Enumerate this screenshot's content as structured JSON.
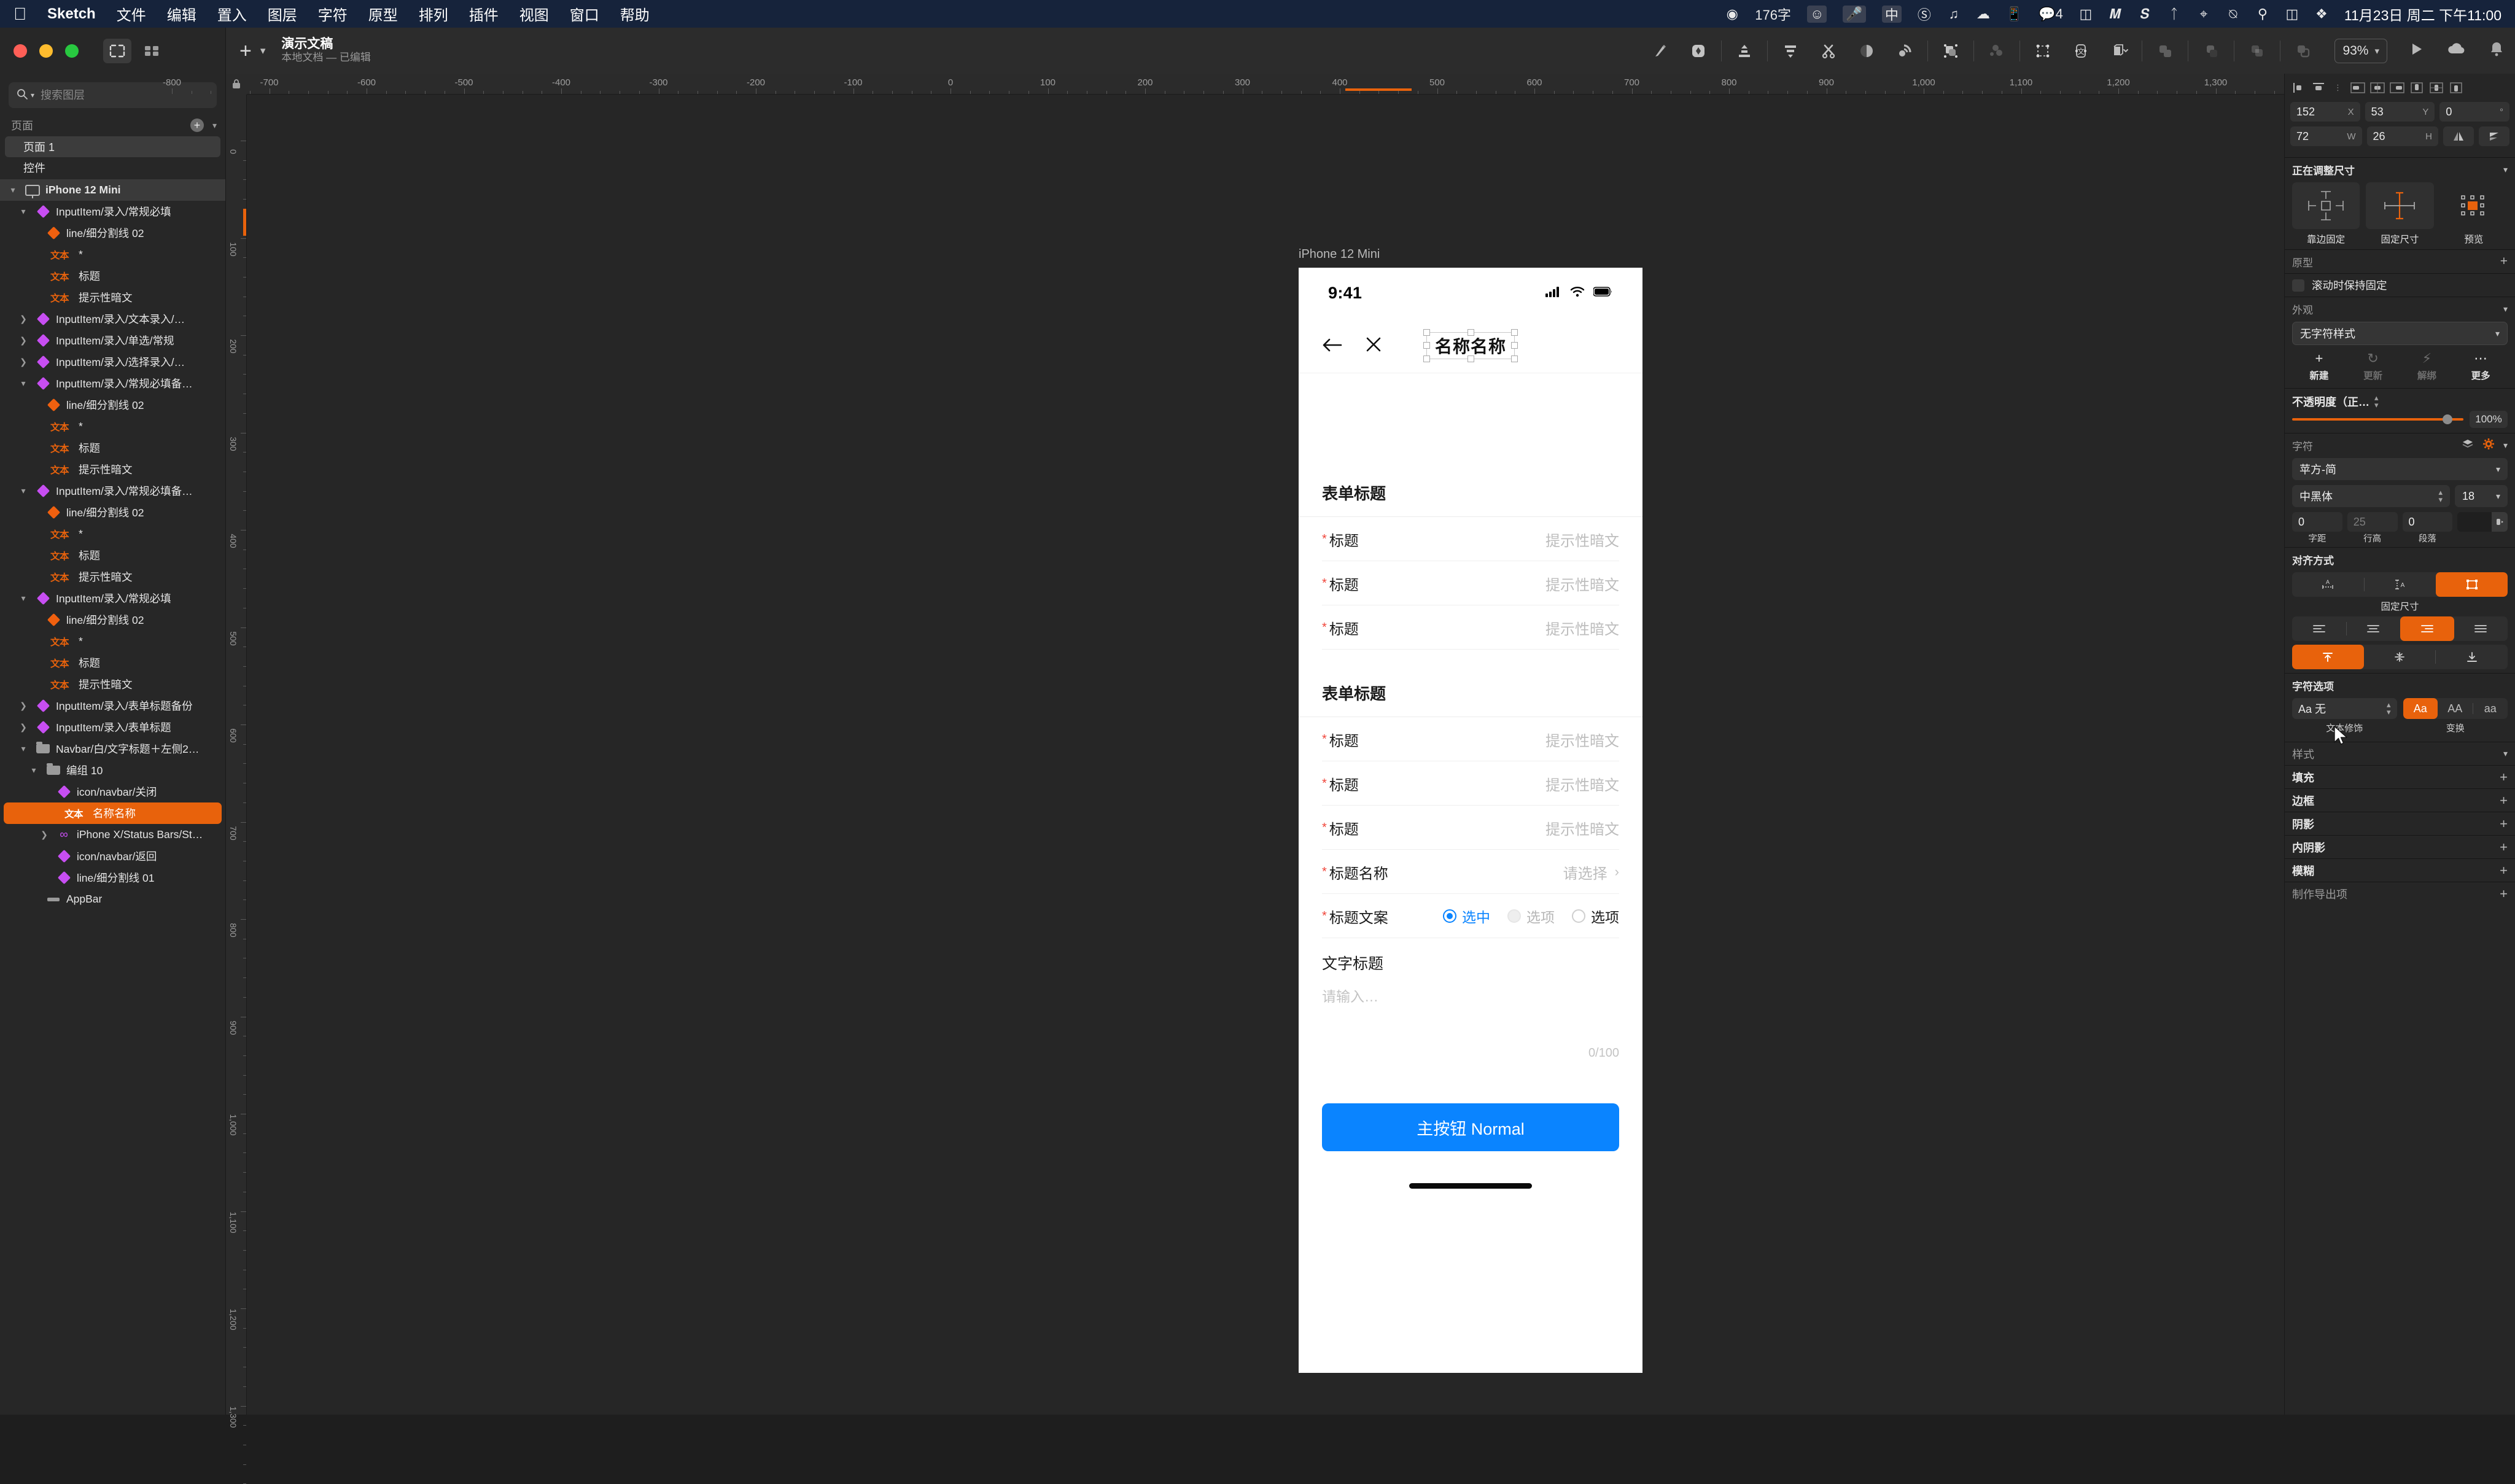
{
  "menubar": {
    "apple": "",
    "app": "Sketch",
    "items": [
      "文件",
      "编辑",
      "置入",
      "图层",
      "字符",
      "原型",
      "排列",
      "插件",
      "视图",
      "窗口",
      "帮助"
    ],
    "status": {
      "word_count": "176字",
      "input_method": "中",
      "notification_count": "4",
      "clock": "11月23日 周二 下午11:00"
    }
  },
  "toolbar": {
    "document_title": "演示文稿",
    "document_subtitle": "本地文档 — 已编辑",
    "zoom_level": "93%"
  },
  "sidebar": {
    "search_placeholder": "搜索图层",
    "pages_label": "页面",
    "pages": [
      {
        "label": "页面 1",
        "selected": true
      },
      {
        "label": "控件",
        "selected": false
      }
    ],
    "layers": [
      {
        "label": "iPhone 12 Mini",
        "indent": 0,
        "kind": "artboard",
        "disc": "down",
        "bold": true,
        "selected": "artboard"
      },
      {
        "label": "InputItem/录入/常规必填",
        "indent": 1,
        "kind": "symbol",
        "disc": "down"
      },
      {
        "label": "line/细分割线 02",
        "indent": 2,
        "kind": "symbol-orange",
        "disc": ""
      },
      {
        "label": "*",
        "indent": 2,
        "kind": "text",
        "disc": ""
      },
      {
        "label": "标题",
        "indent": 2,
        "kind": "text",
        "disc": ""
      },
      {
        "label": "提示性暗文",
        "indent": 2,
        "kind": "text",
        "disc": ""
      },
      {
        "label": "InputItem/录入/文本录入/…",
        "indent": 1,
        "kind": "symbol",
        "disc": "right"
      },
      {
        "label": "InputItem/录入/单选/常规",
        "indent": 1,
        "kind": "symbol",
        "disc": "right"
      },
      {
        "label": "InputItem/录入/选择录入/…",
        "indent": 1,
        "kind": "symbol",
        "disc": "right"
      },
      {
        "label": "InputItem/录入/常规必填备…",
        "indent": 1,
        "kind": "symbol",
        "disc": "down"
      },
      {
        "label": "line/细分割线 02",
        "indent": 2,
        "kind": "symbol-orange",
        "disc": ""
      },
      {
        "label": "*",
        "indent": 2,
        "kind": "text",
        "disc": ""
      },
      {
        "label": "标题",
        "indent": 2,
        "kind": "text",
        "disc": ""
      },
      {
        "label": "提示性暗文",
        "indent": 2,
        "kind": "text",
        "disc": ""
      },
      {
        "label": "InputItem/录入/常规必填备…",
        "indent": 1,
        "kind": "symbol",
        "disc": "down"
      },
      {
        "label": "line/细分割线 02",
        "indent": 2,
        "kind": "symbol-orange",
        "disc": ""
      },
      {
        "label": "*",
        "indent": 2,
        "kind": "text",
        "disc": ""
      },
      {
        "label": "标题",
        "indent": 2,
        "kind": "text",
        "disc": ""
      },
      {
        "label": "提示性暗文",
        "indent": 2,
        "kind": "text",
        "disc": ""
      },
      {
        "label": "InputItem/录入/常规必填",
        "indent": 1,
        "kind": "symbol",
        "disc": "down"
      },
      {
        "label": "line/细分割线 02",
        "indent": 2,
        "kind": "symbol-orange",
        "disc": ""
      },
      {
        "label": "*",
        "indent": 2,
        "kind": "text",
        "disc": ""
      },
      {
        "label": "标题",
        "indent": 2,
        "kind": "text",
        "disc": ""
      },
      {
        "label": "提示性暗文",
        "indent": 2,
        "kind": "text",
        "disc": ""
      },
      {
        "label": "InputItem/录入/表单标题备份",
        "indent": 1,
        "kind": "symbol",
        "disc": "right"
      },
      {
        "label": "InputItem/录入/表单标题",
        "indent": 1,
        "kind": "symbol",
        "disc": "right"
      },
      {
        "label": "Navbar/白/文字标题＋左侧2…",
        "indent": 1,
        "kind": "folder",
        "disc": "down"
      },
      {
        "label": "编组 10",
        "indent": 2,
        "kind": "folder",
        "disc": "down"
      },
      {
        "label": "icon/navbar/关闭",
        "indent": 3,
        "kind": "symbol",
        "disc": ""
      },
      {
        "label": "名称名称",
        "indent": 3,
        "kind": "text",
        "disc": "",
        "selected": "orange"
      },
      {
        "label": "iPhone X/Status Bars/St…",
        "indent": 3,
        "kind": "symlink",
        "disc": "right"
      },
      {
        "label": "icon/navbar/返回",
        "indent": 3,
        "kind": "symbol",
        "disc": ""
      },
      {
        "label": "line/细分割线 01",
        "indent": 3,
        "kind": "symbol",
        "disc": ""
      },
      {
        "label": "AppBar",
        "indent": 2,
        "kind": "bar",
        "disc": ""
      }
    ]
  },
  "ruler": {
    "h_labels": [
      "-800",
      "-700",
      "-600",
      "-500",
      "-400",
      "-300",
      "-200",
      "-100",
      "0",
      "100",
      "200",
      "300",
      "400",
      "500",
      "600",
      "700",
      "800",
      "900",
      "1,000",
      "1,100",
      "1,200",
      "1,300"
    ],
    "v_labels": [
      "0",
      "100",
      "200",
      "300",
      "400",
      "500",
      "600",
      "700",
      "800",
      "900",
      "1,000",
      "1,100",
      "1,200",
      "1,300"
    ]
  },
  "artboard": {
    "name": "iPhone 12 Mini",
    "status_bar": {
      "time": "9:41"
    },
    "navbar": {
      "title": "名称名称"
    },
    "sections": [
      {
        "title": "表单标题",
        "rows": [
          {
            "required": true,
            "label": "标题",
            "value": "提示性暗文",
            "type": "input"
          },
          {
            "required": true,
            "label": "标题",
            "value": "提示性暗文",
            "type": "input"
          },
          {
            "required": true,
            "label": "标题",
            "value": "提示性暗文",
            "type": "input"
          }
        ]
      },
      {
        "title": "表单标题",
        "rows": [
          {
            "required": true,
            "label": "标题",
            "value": "提示性暗文",
            "type": "input"
          },
          {
            "required": true,
            "label": "标题",
            "value": "提示性暗文",
            "type": "input"
          },
          {
            "required": true,
            "label": "标题",
            "value": "提示性暗文",
            "type": "input"
          },
          {
            "required": true,
            "label": "标题名称",
            "value": "请选择",
            "type": "select"
          },
          {
            "required": true,
            "label": "标题文案",
            "type": "radio",
            "options": [
              {
                "label": "选中",
                "state": "checked"
              },
              {
                "label": "选项",
                "state": "disabled"
              },
              {
                "label": "选项",
                "state": "unchecked"
              }
            ]
          }
        ]
      }
    ],
    "textarea": {
      "title": "文字标题",
      "placeholder": "请输入…",
      "counter": "0/100"
    },
    "primary_button": "主按钮 Normal"
  },
  "inspector": {
    "x": "152",
    "x_unit": "X",
    "y": "53",
    "y_unit": "Y",
    "rotation": "0",
    "rotation_unit": "°",
    "w": "72",
    "w_unit": "W",
    "h": "26",
    "h_unit": "H",
    "resize_title": "正在调整尺寸",
    "resize_options": [
      "靠边固定",
      "固定尺寸",
      "预览"
    ],
    "prototype_title": "原型",
    "fixed_on_scroll": "滚动时保持固定",
    "appearance_title": "外观",
    "text_style": "无字符样式",
    "style_actions": [
      "新建",
      "更新",
      "解绑",
      "更多"
    ],
    "opacity_title": "不透明度（正…",
    "opacity_value": "100%",
    "character_title": "字符",
    "font_family": "苹方-简",
    "font_weight": "中黑体",
    "font_size": "18",
    "kerning": "0",
    "kerning_label": "字距",
    "line_height": "25",
    "line_height_label": "行高",
    "paragraph": "0",
    "paragraph_label": "段落",
    "alignment_title": "对齐方式",
    "fixed_size_caption": "固定尺寸",
    "char_options_title": "字符选项",
    "decoration_value": "Aa 无",
    "decoration_label": "文本修饰",
    "transform_label": "变换",
    "transform_options": [
      "Aa",
      "AA",
      "aa"
    ],
    "style_title": "样式",
    "style_rows": [
      "填充",
      "边框",
      "阴影",
      "内阴影",
      "模糊"
    ],
    "export_title": "制作导出项"
  },
  "colors": {
    "accent_orange": "#e8620c",
    "accent_blue": "#0a84ff",
    "required_red": "#f0453a",
    "symbol_purple": "#c74ef2",
    "menubar_blue": "#16233b"
  }
}
